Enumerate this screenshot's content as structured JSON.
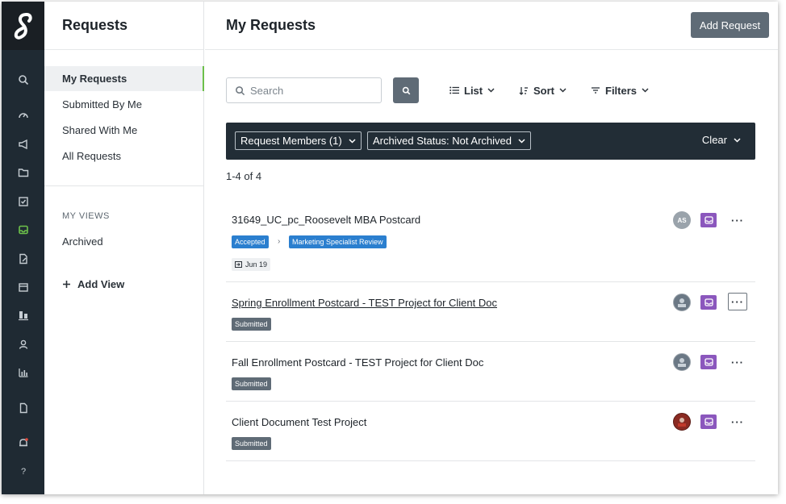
{
  "sidebar": {
    "title": "Requests",
    "items": [
      {
        "label": "My Requests"
      },
      {
        "label": "Submitted By Me"
      },
      {
        "label": "Shared With Me"
      },
      {
        "label": "All Requests"
      }
    ],
    "views_heading": "MY VIEWS",
    "views": [
      {
        "label": "Archived"
      }
    ],
    "add_view": "Add View"
  },
  "header": {
    "title": "My Requests",
    "add_button": "Add Request"
  },
  "toolbar": {
    "search_placeholder": "Search",
    "list_label": "List",
    "sort_label": "Sort",
    "filters_label": "Filters"
  },
  "filters": {
    "members": "Request Members (1)",
    "archived": "Archived Status: Not Archived",
    "clear": "Clear"
  },
  "count": "1-4 of 4",
  "requests": [
    {
      "title": "31649_UC_pc_Roosevelt MBA Postcard",
      "status": "Accepted",
      "stage": "Marketing Specialist Review",
      "date": "Jun 19",
      "avatar": "AS"
    },
    {
      "title": "Spring Enrollment Postcard - TEST Project for Client Doc",
      "status": "Submitted"
    },
    {
      "title": "Fall Enrollment Postcard - TEST Project for Client Doc",
      "status": "Submitted"
    },
    {
      "title": "Client Document Test Project",
      "status": "Submitted"
    }
  ],
  "colors": {
    "rail": "#1f2a33",
    "accent": "#6cc04a",
    "primary_button": "#5f6b76",
    "filter_bar": "#222d36",
    "status_blue": "#2b7fcf",
    "inbox_purple": "#8b57bd"
  }
}
